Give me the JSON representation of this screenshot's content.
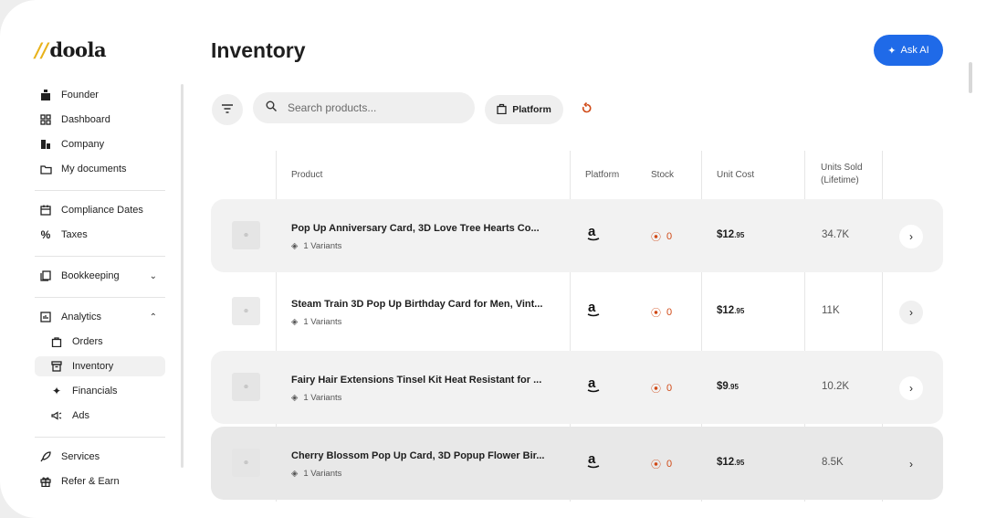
{
  "sidebar": {
    "logo_prefix": "//",
    "logo_text": "doola",
    "items": [
      {
        "label": "Founder",
        "icon": "founder-icon"
      },
      {
        "label": "Dashboard",
        "icon": "dashboard-grid-icon"
      },
      {
        "label": "Company",
        "icon": "company-icon"
      },
      {
        "label": "My documents",
        "icon": "folder-icon"
      },
      {
        "label": "Compliance Dates",
        "icon": "calendar-icon"
      },
      {
        "label": "Taxes",
        "icon": "percent-icon"
      },
      {
        "label": "Bookkeeping",
        "icon": "book-icon"
      },
      {
        "label": "Analytics",
        "icon": "analytics-icon"
      },
      {
        "label": "Orders",
        "icon": "shopping-bag-icon"
      },
      {
        "label": "Inventory",
        "icon": "inventory-box-icon"
      },
      {
        "label": "Financials",
        "icon": "sparkle-icon"
      },
      {
        "label": "Ads",
        "icon": "megaphone-icon"
      },
      {
        "label": "Services",
        "icon": "rocket-icon"
      },
      {
        "label": "Refer & Earn",
        "icon": "gift-icon"
      }
    ]
  },
  "header": {
    "title": "Inventory",
    "ask_ai_label": "Ask AI"
  },
  "toolbar": {
    "search_placeholder": "Search products...",
    "platform_label": "Platform"
  },
  "table": {
    "columns": {
      "product": "Product",
      "platform": "Platform",
      "stock": "Stock",
      "unit_cost": "Unit Cost",
      "units_sold": "Units Sold (Lifetime)"
    },
    "rows": [
      {
        "thumb": "⊗",
        "name": "Pop Up Anniversary Card, 3D Love Tree Hearts Co...",
        "variants": "1 Variants",
        "platform": "a",
        "stock": "0",
        "cost_main": "$12",
        "cost_cents": ".95",
        "units_sold": "34.7K"
      },
      {
        "thumb": "⊗",
        "name": "Steam Train 3D Pop Up Birthday Card for Men, Vint...",
        "variants": "1 Variants",
        "platform": "a",
        "stock": "0",
        "cost_main": "$12",
        "cost_cents": ".95",
        "units_sold": "11K"
      },
      {
        "thumb": "⊗",
        "name": "Fairy Hair Extensions Tinsel Kit Heat Resistant for ...",
        "variants": "1 Variants",
        "platform": "a",
        "stock": "0",
        "cost_main": "$9",
        "cost_cents": ".95",
        "units_sold": "10.2K"
      },
      {
        "thumb": "⊗",
        "name": "Cherry Blossom Pop Up Card, 3D Popup Flower Bir...",
        "variants": "1 Variants",
        "platform": "a",
        "stock": "0",
        "cost_main": "$12",
        "cost_cents": ".95",
        "units_sold": "8.5K"
      }
    ]
  },
  "colors": {
    "accent": "#1f6ae8",
    "stock_alert": "#d04a17",
    "logo_slash": "#e8b21b"
  }
}
